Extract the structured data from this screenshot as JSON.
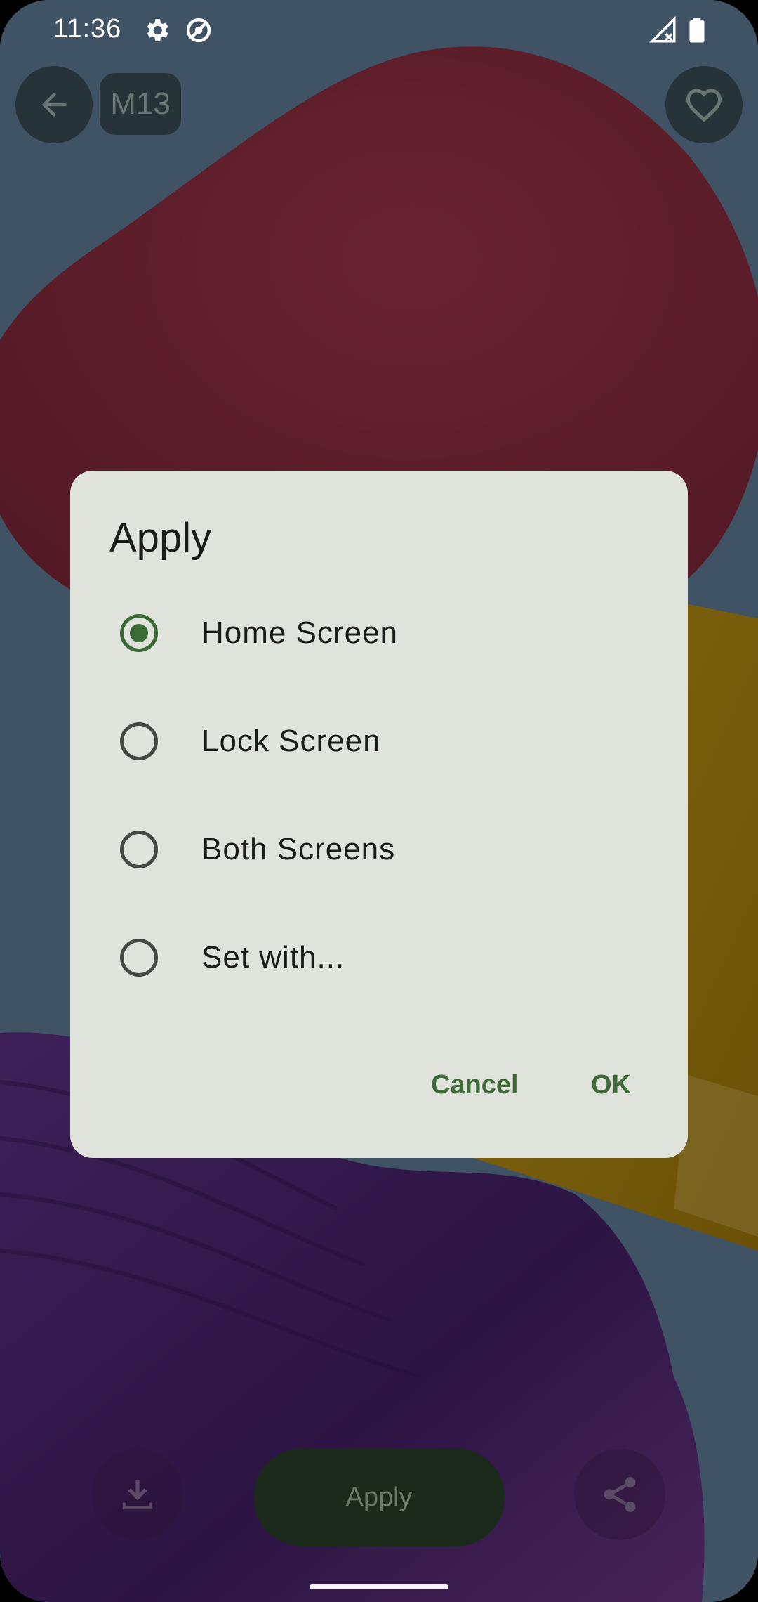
{
  "status_bar": {
    "time": "11:36",
    "icons": [
      "gear-icon",
      "data-saver-icon",
      "signal-icon",
      "battery-icon"
    ]
  },
  "top_bar": {
    "back_icon": "arrow-back-icon",
    "model_label": "M13",
    "favorite_icon": "heart-outline-icon"
  },
  "dialog": {
    "title": "Apply",
    "options": [
      {
        "label": "Home Screen",
        "selected": true
      },
      {
        "label": "Lock Screen",
        "selected": false
      },
      {
        "label": "Both Screens",
        "selected": false
      },
      {
        "label": "Set with...",
        "selected": false
      }
    ],
    "cancel_label": "Cancel",
    "ok_label": "OK"
  },
  "bottom_bar": {
    "download_icon": "download-icon",
    "apply_label": "Apply",
    "share_icon": "share-icon"
  },
  "colors": {
    "accent": "#3b6b34",
    "dialog_surface": "#e0e3dc",
    "wallpaper_red": "#a03348",
    "wallpaper_yellow": "#d6ad19",
    "wallpaper_purple": "#5c2d86"
  }
}
